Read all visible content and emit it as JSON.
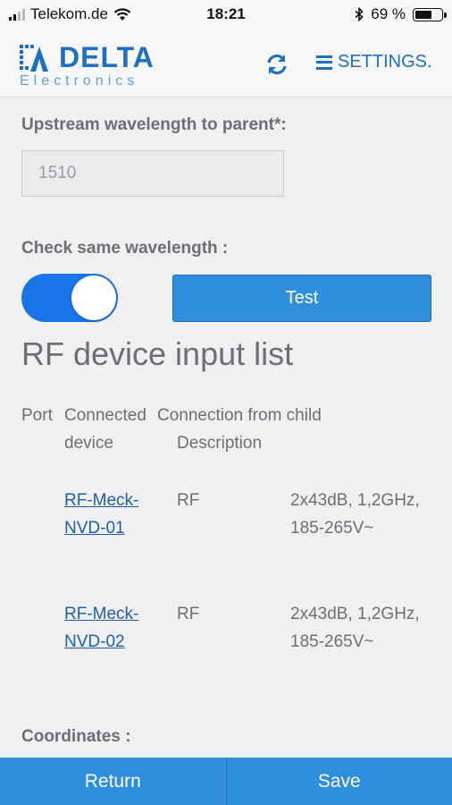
{
  "status_bar": {
    "carrier": "Telekom.de",
    "time": "18:21",
    "battery": "69 %",
    "battery_level": 0.69
  },
  "header": {
    "logo_name": "DELTA",
    "logo_sub": "Electronics",
    "settings_label": "SETTINGS.",
    "icons": [
      "refresh-icon",
      "menu-icon"
    ],
    "accent_color": "#1f6fc3"
  },
  "form": {
    "upstream_label": "Upstream wavelength to parent*:",
    "upstream_value": "1510",
    "check_label": "Check same wavelength :",
    "toggle_on": true,
    "test_label": "Test"
  },
  "rf_list": {
    "title": "RF device input list",
    "columns": [
      "Port",
      "Connected device",
      "Connection from child",
      "Description"
    ],
    "rows": [
      {
        "port": "",
        "device": "RF-Meck-NVD-01",
        "connection": "RF",
        "description": "2x43dB, 1,2GHz, 185-265V~"
      },
      {
        "port": "",
        "device": "RF-Meck-NVD-02",
        "connection": "RF",
        "description": "2x43dB, 1,2GHz, 185-265V~"
      }
    ]
  },
  "coordinates_label": "Coordinates :",
  "footer": {
    "return_label": "Return",
    "save_label": "Save",
    "color": "#2f8fde"
  }
}
